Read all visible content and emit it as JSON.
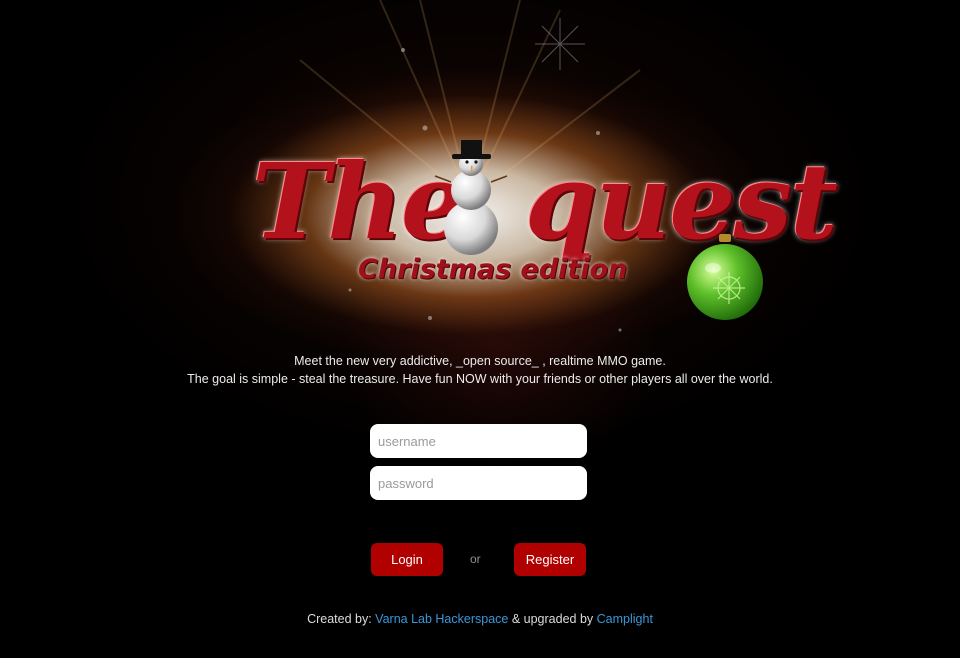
{
  "logo": {
    "word_left": "The",
    "word_right": "quest",
    "subtitle": "Christmas edition"
  },
  "intro": {
    "line1": "Meet the new very addictive, _open source_ , realtime MMO game.",
    "line2": "The goal is simple - steal the treasure. Have fun NOW with your friends or other players all over the world."
  },
  "form": {
    "username_placeholder": "username",
    "password_placeholder": "password",
    "login_label": "Login",
    "or_label": "or",
    "register_label": "Register"
  },
  "footer": {
    "prefix": "Created by:",
    "link1": "Varna Lab Hackerspace",
    "middle": "& upgraded by",
    "link2": "Camplight"
  },
  "colors": {
    "background": "#000000",
    "button": "#b10000",
    "link": "#3a97d8",
    "logo_red": "#b3121c",
    "ornament_green": "#5fc02a"
  }
}
